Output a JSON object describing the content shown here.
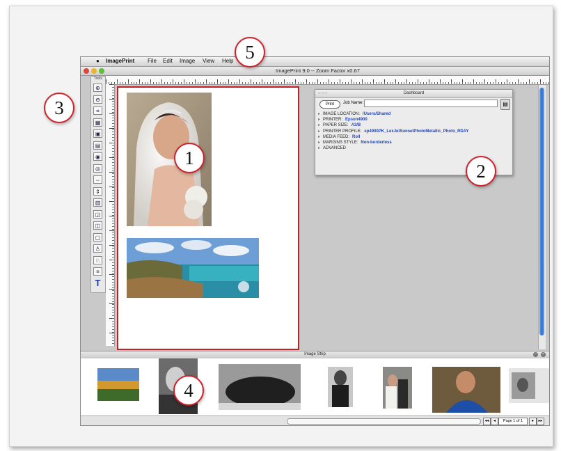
{
  "menubar": {
    "apple": "",
    "app_name": "ImagePrint",
    "items": [
      "File",
      "Edit",
      "Image",
      "View",
      "Help"
    ]
  },
  "window": {
    "title": "ImagePrint 9.0 -- Zoom Factor x0.67"
  },
  "tools": {
    "title": "Tools",
    "items": [
      {
        "icon": "zoom-in-icon",
        "glyph": "⊕"
      },
      {
        "icon": "zoom-out-icon",
        "glyph": "⊖"
      },
      {
        "icon": "crop-icon",
        "glyph": "⌗"
      },
      {
        "icon": "grid-icon",
        "glyph": "▦"
      },
      {
        "icon": "image-icon",
        "glyph": "▣"
      },
      {
        "icon": "arrange-icon",
        "glyph": "▤"
      },
      {
        "icon": "color-icon",
        "glyph": "◉"
      },
      {
        "icon": "target-icon",
        "glyph": "◎"
      },
      {
        "icon": "flip-horizontal-icon",
        "glyph": "⇔"
      },
      {
        "icon": "flip-vertical-icon",
        "glyph": "⇕"
      },
      {
        "icon": "align-icon",
        "glyph": "▥"
      },
      {
        "icon": "resize-icon",
        "glyph": "◲"
      },
      {
        "icon": "select-icon",
        "glyph": "◫"
      },
      {
        "icon": "frame-icon",
        "glyph": "▢"
      },
      {
        "icon": "person-icon",
        "glyph": "♙"
      },
      {
        "icon": "figure-icon",
        "glyph": "♘"
      },
      {
        "icon": "layers-icon",
        "glyph": "≡"
      },
      {
        "icon": "text-tool-icon",
        "glyph": "T"
      }
    ]
  },
  "dashboard": {
    "title": "Dashboard",
    "print_label": "Print",
    "job_name_label": "Job Name:",
    "job_name_value": "",
    "properties": [
      {
        "label": "IMAGE LOCATION:",
        "value": "/Users/Shared"
      },
      {
        "label": "PRINTER:",
        "value": "Epson4900"
      },
      {
        "label": "PAPER SIZE:",
        "value": "A3/B"
      },
      {
        "label": "PRINTER PROFILE:",
        "value": "ep4900PK_LexJetSunsetPhotoMetallic_Photo_RDAY"
      },
      {
        "label": "MEDIA FEED:",
        "value": "Roll"
      },
      {
        "label": "MARGINS STYLE:",
        "value": "Non-borderless"
      },
      {
        "label": "ADVANCED",
        "value": ""
      }
    ]
  },
  "image_strip": {
    "title": "Image Strip"
  },
  "pagination": {
    "page_label": "Page 1 of 1"
  },
  "callouts": [
    "1",
    "2",
    "3",
    "4",
    "5"
  ],
  "colors": {
    "callout_border": "#d0202a",
    "page_border": "#c02026",
    "value_text": "#2346b8"
  }
}
